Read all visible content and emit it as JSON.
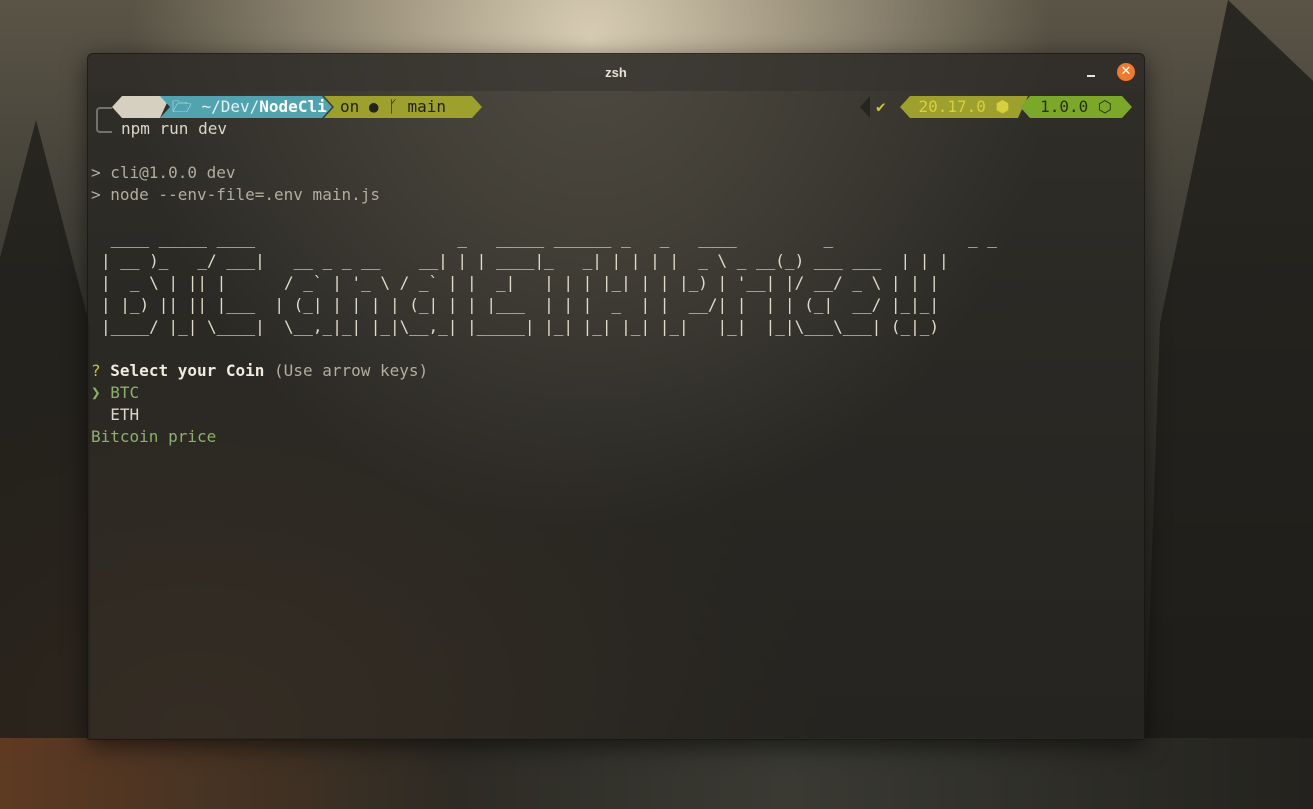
{
  "window": {
    "title": "zsh"
  },
  "prompt": {
    "os_icon": "linux-penguin-icon",
    "dir_icon": "folder-icon",
    "dir_prefix": "~/Dev/",
    "dir_name": "NodeCli",
    "git_on": "on",
    "git_host_icon": "github-icon",
    "git_branch_icon": "branch-icon",
    "git_branch": "main",
    "status_check": "✔",
    "node_version": "20.17.0",
    "node_icon": "hexagon-icon",
    "pkg_version": "1.0.0",
    "pkg_icon": "package-icon"
  },
  "command": "npm run dev",
  "output": [
    "> cli@1.0.0 dev",
    "> node --env-file=.env main.js"
  ],
  "banner": [
    " ____ _____ ____                     _   _____ ______ _   _   ____         _              _ _",
    "| __ )_   _/ ___|   __ _ _ __    __| | | ____|_   _| | | | |  _ \\ _ __(_) ___ ___  | | |",
    "|  _ \\ | || |      / _` | '_ \\ / _` | |  _|   | | | |_| | | |_) | '__| |/ __/ _ \\ | | |",
    "| |_) || || |___  | (_| | | | | (_| | | |___  | | |  _  | |  __/| |  | | (_|  __/ |_|_|",
    "|____/ |_| \\____|  \\__,_|_| |_|\\__,_| |_____| |_| |_| |_| |_|   |_|  |_|\\___\\___| (_|_)"
  ],
  "question": {
    "marker": "?",
    "text": "Select your Coin",
    "hint": "(Use arrow keys)"
  },
  "options": [
    {
      "pointer": "❯",
      "label": "BTC",
      "selected": true
    },
    {
      "pointer": " ",
      "label": "ETH",
      "selected": false
    }
  ],
  "description": "Bitcoin price",
  "colors": {
    "dir_segment": "#51a3b0",
    "git_segment": "#9ea02e",
    "version_segment": "#7ca82a",
    "close_button": "#ee7a2f",
    "selected": "#8cb06b"
  }
}
